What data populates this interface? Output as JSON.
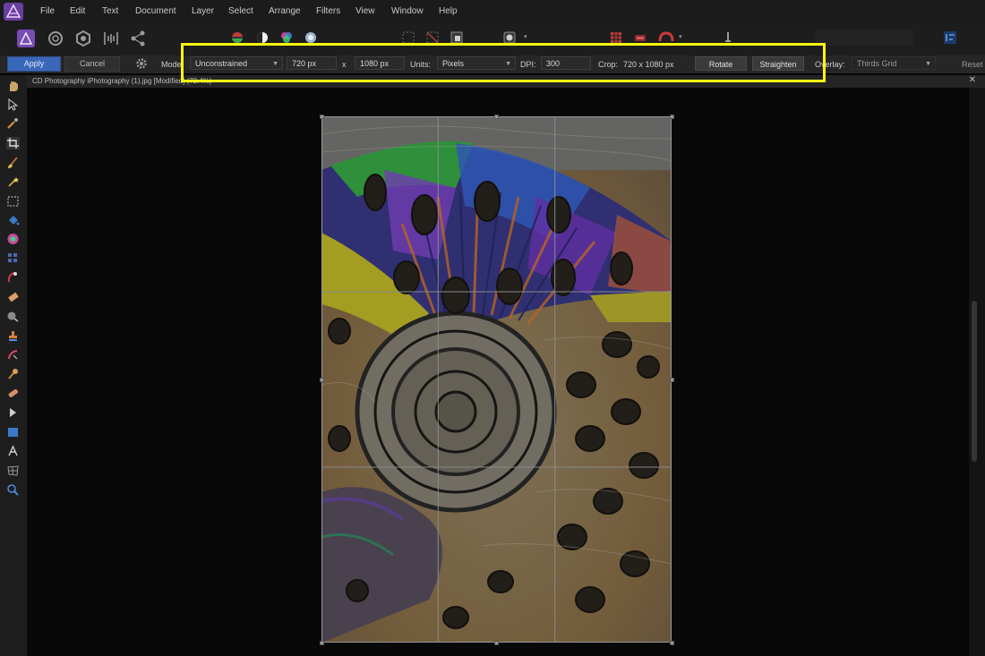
{
  "menu": [
    "File",
    "Edit",
    "Text",
    "Document",
    "Layer",
    "Select",
    "Arrange",
    "Filters",
    "View",
    "Window",
    "Help"
  ],
  "context_bar": {
    "apply": "Apply",
    "cancel": "Cancel",
    "mode_label": "Mode:",
    "mode_value": "Unconstrained",
    "width": "720 px",
    "times": "x",
    "height": "1080 px",
    "units_label": "Units:",
    "units_value": "Pixels",
    "dpi_label": "DPI:",
    "dpi_value": "300",
    "crop_label": "Crop:",
    "crop_value": "720 x 1080 px",
    "rotate": "Rotate",
    "straighten": "Straighten",
    "overlay_label": "Overlay:",
    "overlay_value": "Thirds Grid",
    "reset": "Reset"
  },
  "document_tab": {
    "title": "CD Photography iPhotography (1).jpg [Modified] (72.4%)"
  },
  "icons": {
    "personas": [
      "photo-persona-icon",
      "liquify-persona-icon",
      "develop-persona-icon",
      "tone-mapping-persona-icon",
      "export-persona-icon"
    ],
    "tools": [
      "view-tool-icon",
      "move-tool-icon",
      "color-picker-icon",
      "crop-tool-icon",
      "paint-brush-icon",
      "flood-select-icon",
      "marquee-icon",
      "fill-icon",
      "gradient-icon",
      "dodge-icon",
      "red-eye-icon",
      "erase-icon",
      "blur-icon",
      "clone-icon",
      "healing-icon",
      "smudge-icon",
      "patch-icon",
      "pen-tool-icon",
      "shape-tool-icon",
      "text-tool-icon",
      "mesh-warp-icon",
      "zoom-tool-icon"
    ]
  },
  "colors": {
    "accent_apply": "#3b67b8",
    "highlight": "#f7f711"
  }
}
